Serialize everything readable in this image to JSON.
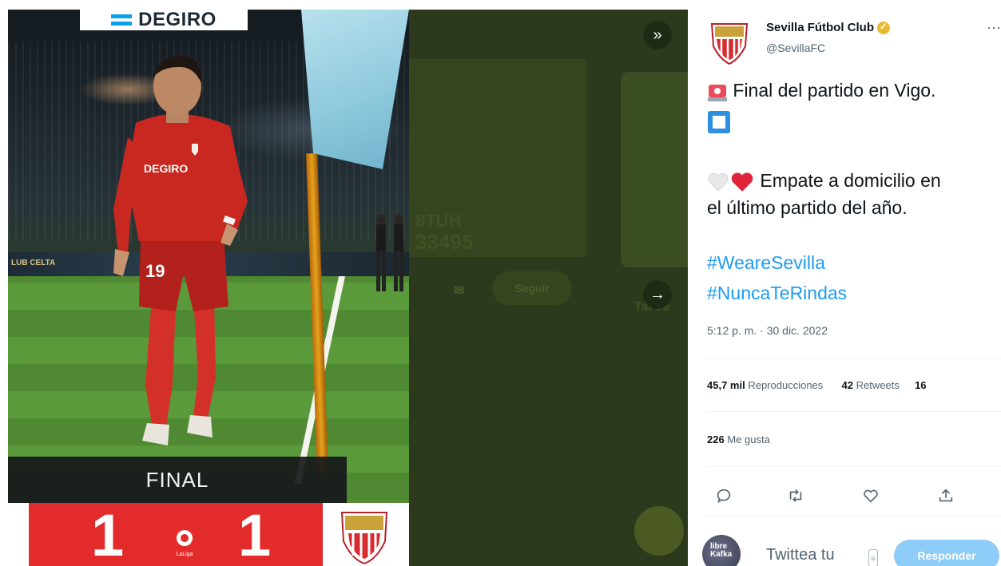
{
  "media": {
    "sponsor": "DEGIRO",
    "ad_board_text": "LUB CELTA",
    "shirt_sponsor": "DEGIRO",
    "shirt_number": "19",
    "result_label": "FINAL",
    "score_home": "1",
    "score_away": "1",
    "league_logo_text": "LaLiga"
  },
  "background": {
    "nav_next_glyph": "»",
    "nav_arrow_glyph": "→",
    "ghost_number_top": "8TUH",
    "ghost_number_bottom": "33495",
    "follow_button": "Seguir",
    "ghost_caption": "Tal ve"
  },
  "tweet": {
    "author_name": "Sevilla Fútbol Club",
    "author_handle": "@SevillaFC",
    "more_icon": "···",
    "line1": "Final del partido en Vigo.",
    "line2": "Empate a domicilio en",
    "line3": "el último partido del año.",
    "hashtag1": "#WeareSevilla",
    "hashtag2": "#NuncaTeRindas",
    "timestamp": "5:12 p. m. · 30 dic. 2022",
    "views_count": "45,7 mil",
    "views_label": "Reproducciones",
    "retweets_count": "42",
    "retweets_label": "Retweets",
    "quotes_count_partial": "16",
    "likes_count": "226",
    "likes_label": "Me gusta",
    "reply_placeholder": "Twittea tu",
    "reply_button": "Responder",
    "reply_avatar_text": "libre\nKafka"
  },
  "colors": {
    "link_blue": "#1d9bf0",
    "reply_button": "#8ecdf8",
    "score_red": "#e32b2b",
    "dim_overlay": "#2c391d",
    "verified_gold": "#e8b931"
  },
  "icons": [
    "nav-next-icon",
    "nav-arrow-icon",
    "reply-icon",
    "retweet-icon",
    "like-icon",
    "share-icon",
    "verified-icon",
    "emoji-icon",
    "siren-emoji",
    "white-square-emoji",
    "white-heart-emoji",
    "red-heart-emoji"
  ]
}
